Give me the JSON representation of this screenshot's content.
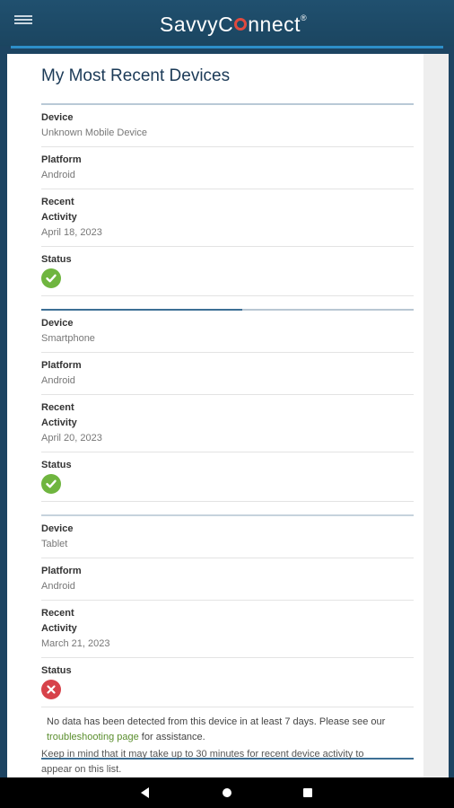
{
  "header": {
    "logo_text_1": "SavvyC",
    "logo_text_2": "nnect",
    "logo_reg": "®"
  },
  "page": {
    "title": "My Most Recent Devices"
  },
  "labels": {
    "device": "Device",
    "platform": "Platform",
    "recent": "Recent",
    "activity": "Activity",
    "status": "Status"
  },
  "devices": [
    {
      "device": "Unknown Mobile Device",
      "platform": "Android",
      "recent_activity": "April 18, 2023",
      "status": "ok",
      "status_color": "#6fb53f"
    },
    {
      "device": "Smartphone",
      "platform": "Android",
      "recent_activity": "April 20, 2023",
      "status": "ok",
      "status_color": "#6fb53f"
    },
    {
      "device": "Tablet",
      "platform": "Android",
      "recent_activity": "March 21, 2023",
      "status": "error",
      "status_color": "#d7424a",
      "note_prefix": "No data has been detected from this device in at least 7 days. Please see our ",
      "note_link": "troubleshooting page",
      "note_suffix": " for assistance."
    }
  ],
  "footer_note": "Keep in mind that it may take up to 30 minutes for recent device activity to appear on this list.",
  "colors": {
    "header_bg": "#1d4462",
    "accent_blue": "#2d8ec9",
    "link_green": "#5a8e2d"
  }
}
